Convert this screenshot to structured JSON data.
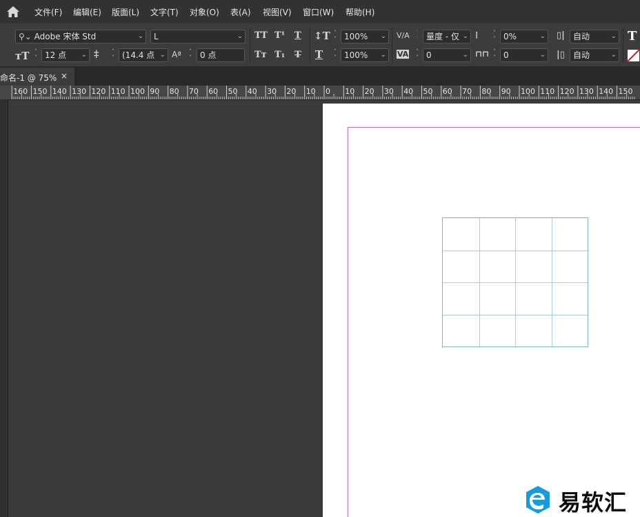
{
  "menu": {
    "home_icon": "home-icon",
    "items": [
      "文件(F)",
      "编辑(E)",
      "版面(L)",
      "文字(T)",
      "对象(O)",
      "表(A)",
      "视图(V)",
      "窗口(W)",
      "帮助(H)"
    ]
  },
  "control_panel": {
    "font_family": "Adobe 宋体 Std",
    "font_style": "L",
    "font_size": "12 点",
    "leading": "(14.4 点",
    "baseline_shift": "0 点",
    "vertical_scale": "100%",
    "horizontal_scale": "100%",
    "kerning": "量度 - 仅",
    "tracking": "0",
    "tsume": "0%",
    "grid_spacing": "0",
    "auto_1": "自动",
    "auto_2": "自动",
    "caps_labels": [
      "TT",
      "T¹",
      "T",
      "Tт",
      "T₁",
      "T"
    ]
  },
  "document_tab": {
    "title": "命名-1 @ 75%",
    "close": "×"
  },
  "ruler": {
    "labels": [
      "160",
      "150",
      "140",
      "130",
      "120",
      "110",
      "100",
      "90",
      "80",
      "70",
      "60",
      "50",
      "40",
      "30",
      "20",
      "10",
      "0",
      "10",
      "20",
      "30",
      "40",
      "50",
      "60",
      "70",
      "80",
      "90",
      "100",
      "110",
      "120",
      "130",
      "140",
      "150"
    ]
  },
  "table": {
    "rows": 4,
    "columns": 4
  },
  "watermark": {
    "text": "易软汇",
    "logo": "yiruanhui-logo",
    "color": "#1a9bd7"
  },
  "colors": {
    "margin_guide": "#b26bb8",
    "table_border": "#7fb2cf"
  }
}
